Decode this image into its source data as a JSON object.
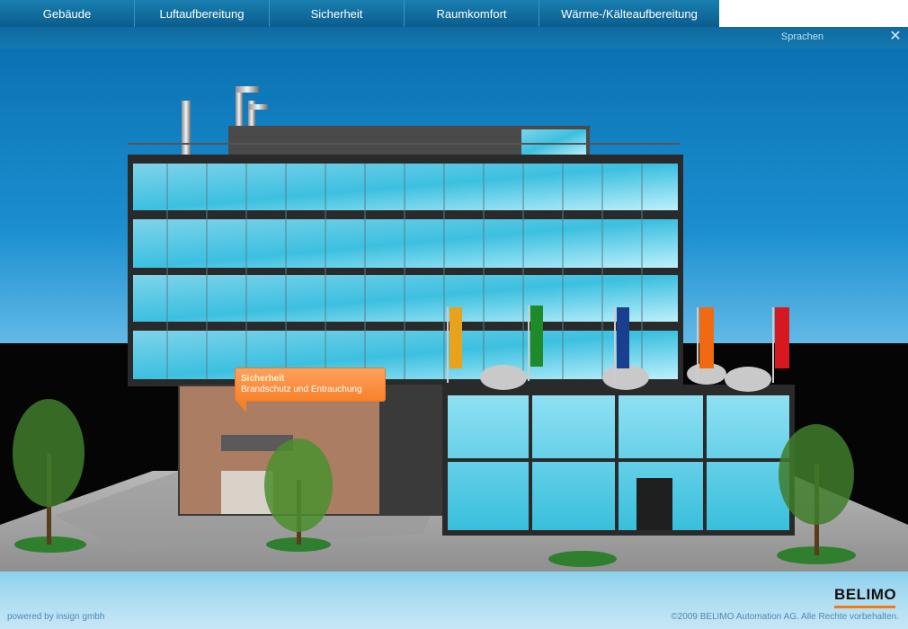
{
  "nav": {
    "tabs": [
      {
        "label": "Gebäude"
      },
      {
        "label": "Luftaufbereitung"
      },
      {
        "label": "Sicherheit"
      },
      {
        "label": "Raumkomfort"
      },
      {
        "label": "Wärme-/Kälteaufbereitung"
      }
    ]
  },
  "subbar": {
    "language_label": "Sprachen",
    "close_icon": "close-icon"
  },
  "tooltip": {
    "title": "Sicherheit",
    "text": "Brandschutz und Entrauchung"
  },
  "footer": {
    "powered_by": "powered by insign gmbh",
    "copyright": "©2009 BELIMO Automation AG. Alle Rechte vorbehalten.",
    "logo_text": "BELIMO"
  },
  "colors": {
    "accent_orange": "#f7822b",
    "nav_blue": "#0a5d8d",
    "sky_blue": "#1c8fd0"
  }
}
